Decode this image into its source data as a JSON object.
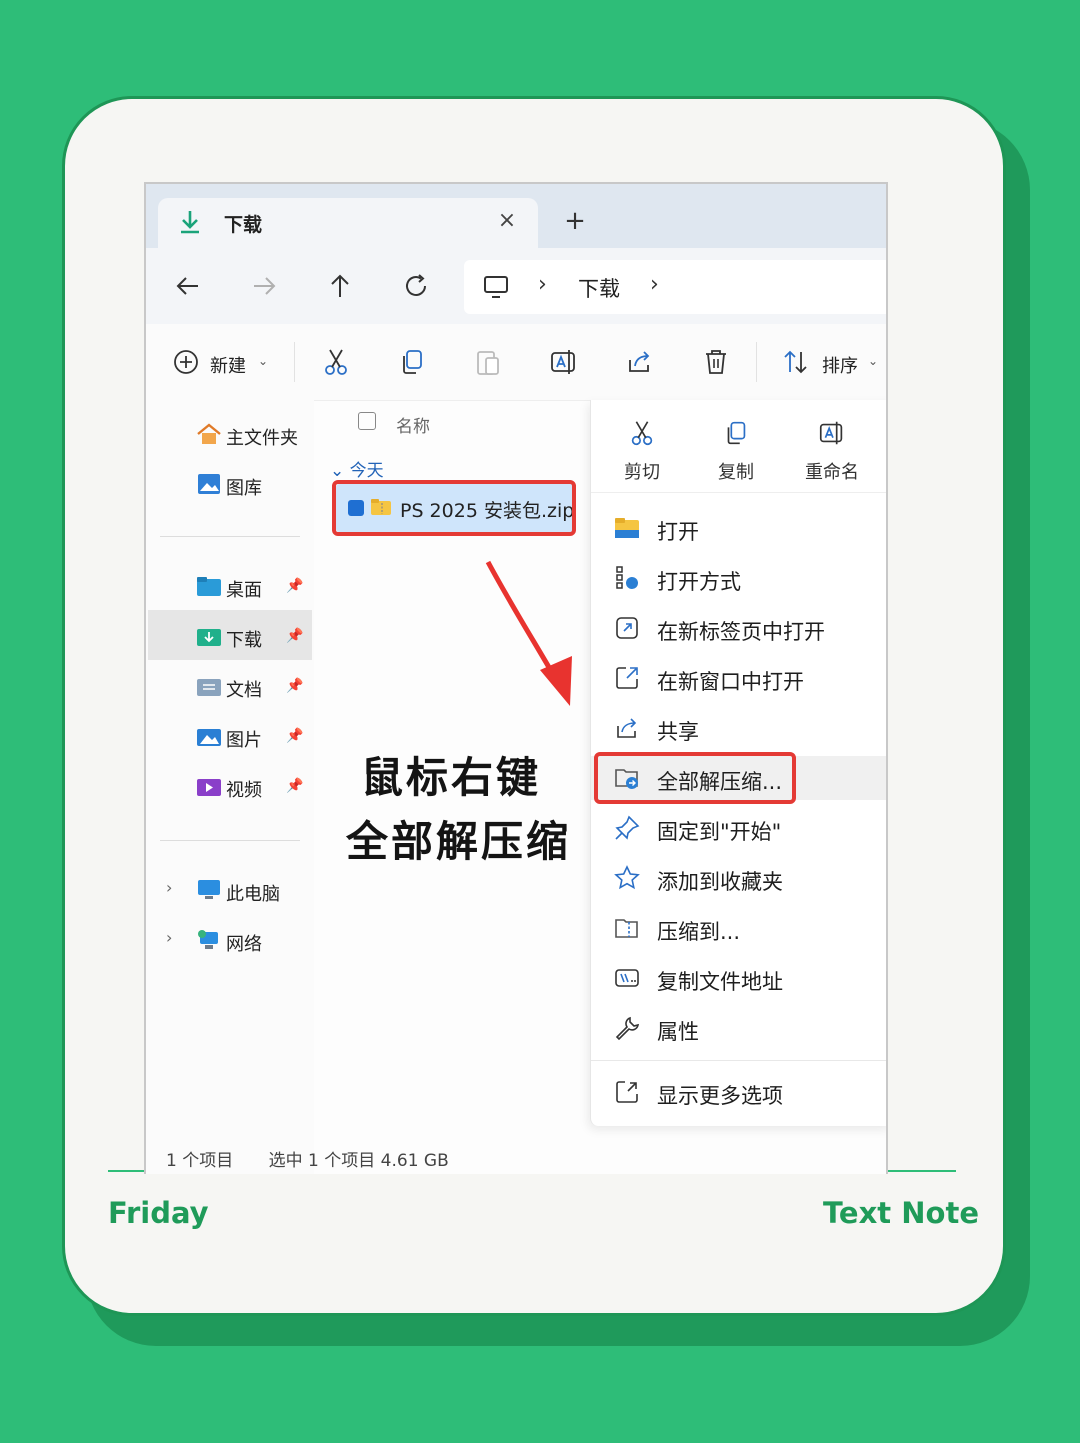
{
  "tab": {
    "title": "下载",
    "close": "×",
    "new_tab": "+"
  },
  "address": {
    "sep1": "›",
    "folder": "下载",
    "sep2": "›"
  },
  "toolbar": {
    "new_label": "新建",
    "sort_label": "排序"
  },
  "sidebar": {
    "items": [
      {
        "label": "主文件夹",
        "icon": "home-icon"
      },
      {
        "label": "图库",
        "icon": "gallery-icon"
      },
      {
        "label": "桌面",
        "icon": "desktop-folder-icon"
      },
      {
        "label": "下载",
        "icon": "downloads-folder-icon"
      },
      {
        "label": "文档",
        "icon": "documents-folder-icon"
      },
      {
        "label": "图片",
        "icon": "pictures-folder-icon"
      },
      {
        "label": "视频",
        "icon": "videos-folder-icon"
      },
      {
        "label": "此电脑",
        "icon": "this-pc-icon"
      },
      {
        "label": "网络",
        "icon": "network-icon"
      }
    ]
  },
  "files": {
    "column_name": "名称",
    "group": "今天",
    "row": {
      "name": "PS 2025 安装包.zip",
      "selected": true
    }
  },
  "annotation": {
    "line1": "鼠标右键",
    "line2": "全部解压缩"
  },
  "status": {
    "count": "1 个项目",
    "selected": "选中 1 个项目  4.61 GB"
  },
  "context_menu": {
    "quick_actions": [
      {
        "label": "剪切",
        "icon": "cut-icon"
      },
      {
        "label": "复制",
        "icon": "copy-icon"
      },
      {
        "label": "重命名",
        "icon": "rename-icon"
      }
    ],
    "items": [
      {
        "label": "打开",
        "icon": "folder-open-icon"
      },
      {
        "label": "打开方式",
        "icon": "open-with-icon"
      },
      {
        "label": "在新标签页中打开",
        "icon": "new-tab-icon"
      },
      {
        "label": "在新窗口中打开",
        "icon": "new-window-icon"
      },
      {
        "label": "共享",
        "icon": "share-icon"
      },
      {
        "label": "全部解压缩...",
        "icon": "extract-all-icon"
      },
      {
        "label": "固定到\"开始\"",
        "icon": "pin-icon"
      },
      {
        "label": "添加到收藏夹",
        "icon": "star-icon"
      },
      {
        "label": "压缩到...",
        "icon": "compress-icon"
      },
      {
        "label": "复制文件地址",
        "icon": "copy-path-icon"
      },
      {
        "label": "属性",
        "icon": "wrench-icon"
      },
      {
        "label": "显示更多选项",
        "icon": "more-options-icon"
      }
    ]
  },
  "footer": {
    "left": "Friday",
    "right": "Text Note"
  },
  "colors": {
    "background": "#2ebd78",
    "accent_red": "#e43a35",
    "selection": "#cfe5fb"
  }
}
